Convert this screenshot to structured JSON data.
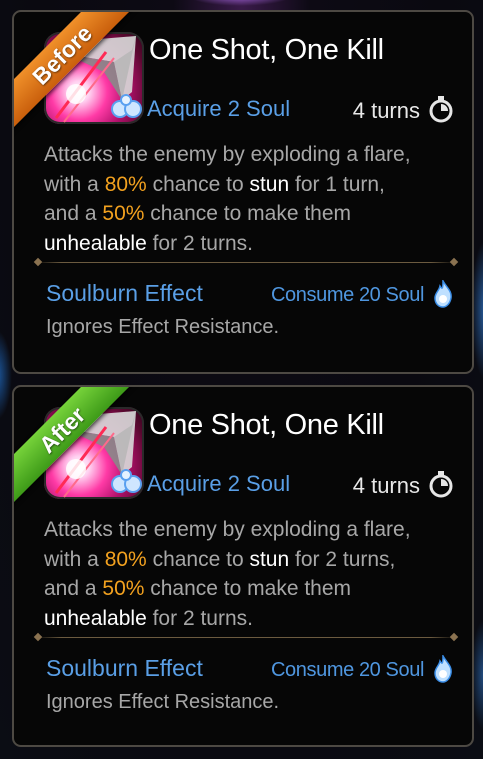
{
  "cards": [
    {
      "ribbon": "Before",
      "ribbon_color": "#e07a1a",
      "skill_name": "One Shot, One Kill",
      "acquire": "Acquire 2 Soul",
      "cooldown": "4 turns",
      "description": {
        "p1": "Attacks the enemy by exploding a flare,",
        "p2a": "with a ",
        "p2b": "80%",
        "p2c": " chance to ",
        "p2d": "stun",
        "p2e": " for 1 turn,",
        "p3a": "and a ",
        "p3b": "50%",
        "p3c": " chance to make them",
        "p4a": "unhealable",
        "p4b": " for 2 turns."
      },
      "soulburn_label": "Soulburn Effect",
      "consume": "Consume 20 Soul",
      "soulburn_desc": "Ignores Effect Resistance."
    },
    {
      "ribbon": "After",
      "ribbon_color": "#5ab42a",
      "skill_name": "One Shot, One Kill",
      "acquire": "Acquire 2 Soul",
      "cooldown": "4 turns",
      "description": {
        "p1": "Attacks the enemy by exploding a flare,",
        "p2a": "with a ",
        "p2b": "80%",
        "p2c": " chance to ",
        "p2d": "stun",
        "p2e": " for 2 turns,",
        "p3a": "and a ",
        "p3b": "50%",
        "p3c": " chance to make them",
        "p4a": "unhealable",
        "p4b": " for 2 turns."
      },
      "soulburn_label": "Soulburn Effect",
      "consume": "Consume 20 Soul",
      "soulburn_desc": "Ignores Effect Resistance."
    }
  ],
  "colors": {
    "highlight_orange": "#f2a11f",
    "keyword_blue": "#5a9fe6",
    "body_gray": "#a7a7a7"
  },
  "icons": {
    "skill": "flare-skill-icon",
    "soul": "soul-orbs-icon",
    "cooldown": "stopwatch-icon",
    "soulburn": "blue-flame-icon"
  }
}
